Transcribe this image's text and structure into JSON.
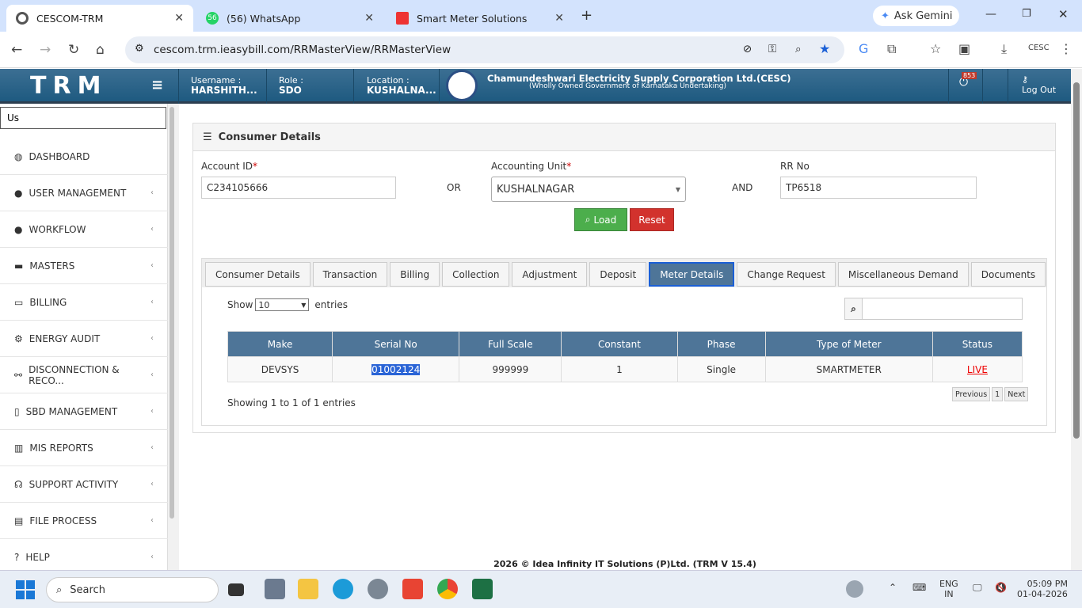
{
  "browser": {
    "tabs": [
      {
        "title": "CESCOM-TRM"
      },
      {
        "title": "(56) WhatsApp",
        "badge": "56"
      },
      {
        "title": "Smart Meter Solutions"
      }
    ],
    "new_tab": "+",
    "url": "cescom.trm.ieasybill.com/RRMasterView/RRMasterView",
    "gemini": "Ask Gemini"
  },
  "header": {
    "logo": "TRM",
    "username_label": "Username :",
    "username": "HARSHITH...",
    "role_label": "Role :",
    "role": "SDO",
    "location_label": "Location :",
    "location": "KUSHALNA...",
    "org_name": "Chamundeshwari Electricity Supply Corporation Ltd.(CESC)",
    "org_sub": "(Wholly Owned Government of Karnataka Undertaking)",
    "notif_count": "853",
    "logout": "Log Out"
  },
  "sidebar": {
    "search_value": "Us",
    "items": [
      {
        "label": "DASHBOARD",
        "icon": "dashboard-icon",
        "chev": false
      },
      {
        "label": "USER MANAGEMENT",
        "icon": "user-icon",
        "chev": true
      },
      {
        "label": "WORKFLOW",
        "icon": "user-icon",
        "chev": true
      },
      {
        "label": "MASTERS",
        "icon": "card-icon",
        "chev": true
      },
      {
        "label": "BILLING",
        "icon": "monitor-icon",
        "chev": true
      },
      {
        "label": "ENERGY AUDIT",
        "icon": "gears-icon",
        "chev": true
      },
      {
        "label": "DISCONNECTION & RECO...",
        "icon": "link-icon",
        "chev": true
      },
      {
        "label": "SBD MANAGEMENT",
        "icon": "mobile-icon",
        "chev": true
      },
      {
        "label": "MIS REPORTS",
        "icon": "chart-icon",
        "chev": true
      },
      {
        "label": "SUPPORT ACTIVITY",
        "icon": "headset-icon",
        "chev": true
      },
      {
        "label": "FILE PROCESS",
        "icon": "file-icon",
        "chev": true
      },
      {
        "label": "HELP",
        "icon": "help-icon",
        "chev": true
      }
    ]
  },
  "panel": {
    "title": "Consumer Details",
    "account_label": "Account ID",
    "account_value": "C234105666",
    "or": "OR",
    "unit_label": "Accounting Unit",
    "unit_value": "KUSHALNAGAR",
    "and": "AND",
    "rr_label": "RR No",
    "rr_value": "TP6518",
    "load": "Load",
    "reset": "Reset",
    "tabs": [
      "Consumer Details",
      "Transaction",
      "Billing",
      "Collection",
      "Adjustment",
      "Deposit",
      "Meter Details",
      "Change Request",
      "Miscellaneous Demand",
      "Documents"
    ],
    "active_tab": "Meter Details",
    "show": "Show",
    "entries_value": "10",
    "entries": "entries",
    "columns": [
      "Make",
      "Serial No",
      "Full Scale",
      "Constant",
      "Phase",
      "Type of Meter",
      "Status"
    ],
    "rows": [
      [
        "DEVSYS",
        "01002124",
        "999999",
        "1",
        "Single",
        "SMARTMETER",
        "LIVE"
      ]
    ],
    "info": "Showing 1 to 1 of 1 entries",
    "prev": "Previous",
    "page": "1",
    "next": "Next"
  },
  "footer": "2026 © Idea Infinity IT Solutions (P)Ltd. (TRM V 15.4)",
  "taskbar": {
    "search": "Search",
    "lang": "ENG",
    "region": "IN",
    "time": "05:09 PM",
    "date": "01-04-2026"
  }
}
